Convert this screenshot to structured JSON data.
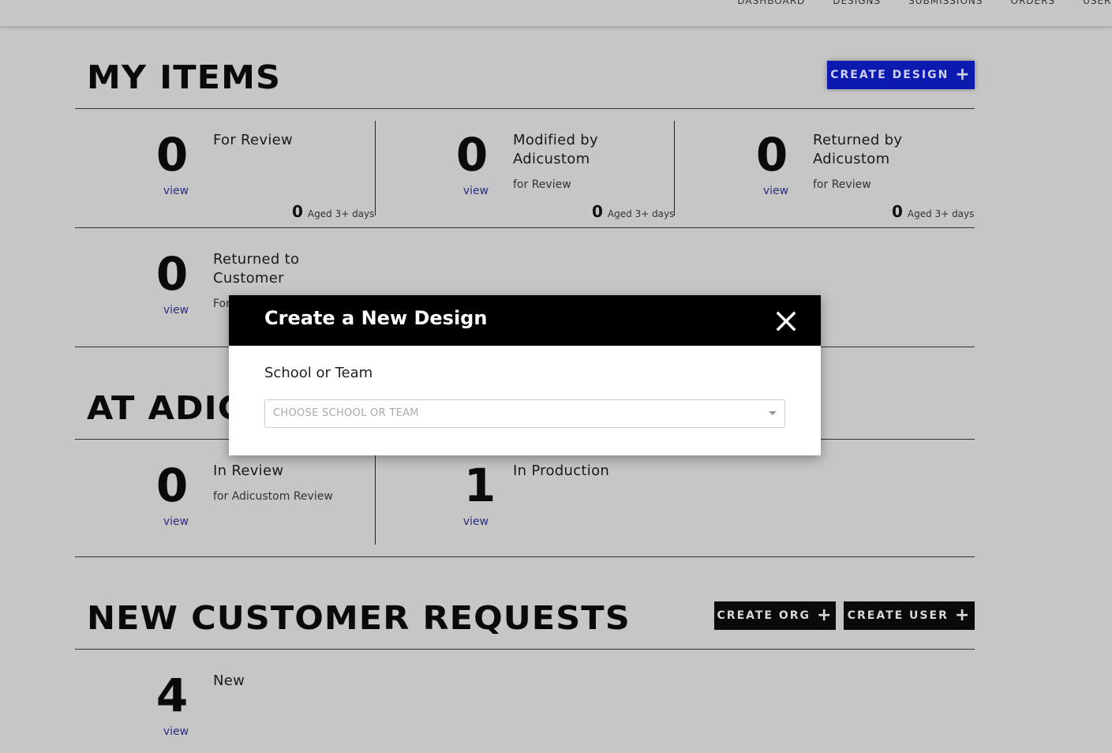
{
  "nav": {
    "items": [
      {
        "name": "dashboard",
        "label": "DASHBOARD"
      },
      {
        "name": "designs",
        "label": "DESIGNS"
      },
      {
        "name": "submissions",
        "label": "SUBMISSIONS"
      },
      {
        "name": "orders",
        "label": "ORDERS"
      },
      {
        "name": "users",
        "label": "USERS"
      }
    ]
  },
  "my_items": {
    "title": "MY ITEMS",
    "create_design_label": "CREATE DESIGN",
    "for_review": {
      "count": "0",
      "view": "view",
      "label": "For Review",
      "aged_count": "0",
      "aged_label": "Aged 3+ days"
    },
    "modified": {
      "count": "0",
      "view": "view",
      "label": "Modified by Adicustom",
      "sub": "for Review",
      "aged_count": "0",
      "aged_label": "Aged 3+ days"
    },
    "returned_by": {
      "count": "0",
      "view": "view",
      "label": "Returned by Adicustom",
      "sub": "for Review",
      "aged_count": "0",
      "aged_label": "Aged 3+ days"
    },
    "returned_to": {
      "count": "0",
      "view": "view",
      "label": "Returned to Customer",
      "sub": "For"
    }
  },
  "at_adicustom": {
    "title": "AT ADIC",
    "in_review": {
      "count": "0",
      "view": "view",
      "label": "In Review",
      "sub": "for Adicustom Review"
    },
    "in_production": {
      "count": "1",
      "view": "view",
      "label": "In Production"
    }
  },
  "new_requests": {
    "title": "NEW CUSTOMER REQUESTS",
    "create_org_label": "CREATE ORG",
    "create_user_label": "CREATE USER",
    "new": {
      "count": "4",
      "view": "view",
      "label": "New"
    }
  },
  "modal": {
    "title": "Create a New Design",
    "field_label": "School or Team",
    "select_placeholder": "CHOOSE SCHOOL OR TEAM"
  },
  "icons": {
    "close": "close-icon",
    "plus": "plus-icon",
    "caret": "chevron-down-icon"
  },
  "colors": {
    "accent_blue": "#0d1ab0",
    "page_bg": "#c6c6c6",
    "link": "#2e2d7c"
  }
}
